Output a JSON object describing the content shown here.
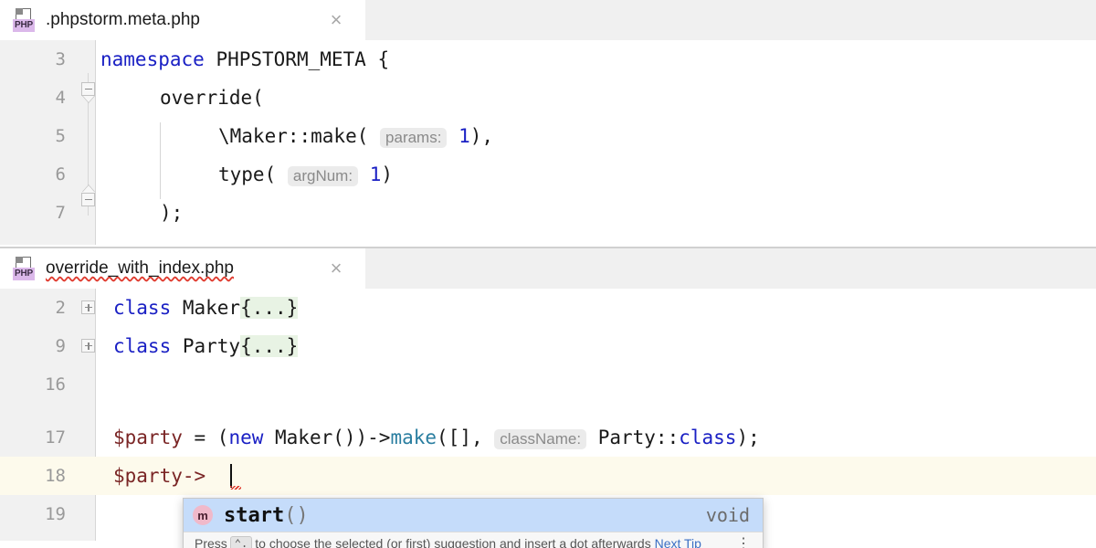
{
  "editors": [
    {
      "tab": {
        "filename": ".phpstorm.meta.php",
        "icon_name": "php-file-icon",
        "icon_badge": "PHP",
        "close_glyph": "×",
        "underline_color": "#9aa3b3",
        "focused": false,
        "misspelled": false
      },
      "lines": [
        {
          "number": "3",
          "text": "namespace PHPSTORM_META {"
        },
        {
          "number": "4",
          "text": "    override("
        },
        {
          "number": "5",
          "text": "        \\Maker::make( params: 1),"
        },
        {
          "number": "6",
          "text": "        type( argNum: 1)"
        },
        {
          "number": "7",
          "text": "    );"
        }
      ],
      "tokens": {
        "keyword_namespace": "namespace",
        "namespace_name": "PHPSTORM_META",
        "open_brace": " {",
        "override_call": "override(",
        "maker_make": "\\Maker::make(",
        "param_hint_params": "params:",
        "num_1": "1",
        "comma_close": "),",
        "type_call": "type(",
        "param_hint_argnum": "argNum:",
        "close_paren": ")",
        "close_stmt": ");"
      }
    },
    {
      "tab": {
        "filename": "override_with_index.php",
        "icon_name": "php-file-icon",
        "icon_badge": "PHP",
        "close_glyph": "×",
        "underline_color": "#4a86c8",
        "focused": true,
        "misspelled": true
      },
      "lines": [
        {
          "number": "2",
          "text": "class Maker{...}"
        },
        {
          "number": "9",
          "text": "class Party{...}"
        },
        {
          "number": "16",
          "text": ""
        },
        {
          "number": "17",
          "text": "$party = (new Maker())->make([], className: Party::class);"
        },
        {
          "number": "18",
          "text": "$party->"
        },
        {
          "number": "19",
          "text": ""
        }
      ],
      "tokens": {
        "kw_class": "class",
        "name_maker": " Maker",
        "name_party": " Party",
        "fold_placeholder": "{...}",
        "var_party": "$party",
        "assign": " = (",
        "kw_new": "new",
        "maker_ctor": " Maker())->",
        "fn_make": "make",
        "make_args_open": "([], ",
        "param_hint_classname": "className:",
        "party_class_prefix": " Party::",
        "kw_class_const": "class",
        "stmt_end": ");",
        "arrow": "$party->"
      },
      "caret_line": "18"
    }
  ],
  "autocomplete": {
    "visible": true,
    "items": [
      {
        "icon_letter": "m",
        "icon_name": "method-icon",
        "name": "start",
        "parens": "()",
        "type": "void",
        "selected": true
      }
    ],
    "footer": {
      "prefix": "Press",
      "shortcut1": "⌃.",
      "middle": "to choose the selected (or first) suggestion and insert a dot afterwards",
      "link": "Next Tip",
      "dots": "⋮"
    }
  },
  "colors": {
    "tab_active_bg": "#ffffff",
    "tabstrip_bg": "#f0f0f0",
    "gutter_bg": "#f1f1f1",
    "caret_line_bg": "#fdfaec",
    "fold_highlight_bg": "#e8f3e4",
    "selection_bg": "#c5dcfa",
    "keyword": "#1a20c4",
    "variable": "#7a2525",
    "function": "#2a7ea0",
    "param_hint_text": "#8a8a8a",
    "param_hint_bg": "#ebebeb",
    "line_number": "#999999",
    "focused_tab_underline": "#4a86c8",
    "unfocused_tab_underline": "#9aa3b3",
    "method_icon_bg": "#f0b9ca",
    "error_squiggle": "#e03b2f"
  }
}
